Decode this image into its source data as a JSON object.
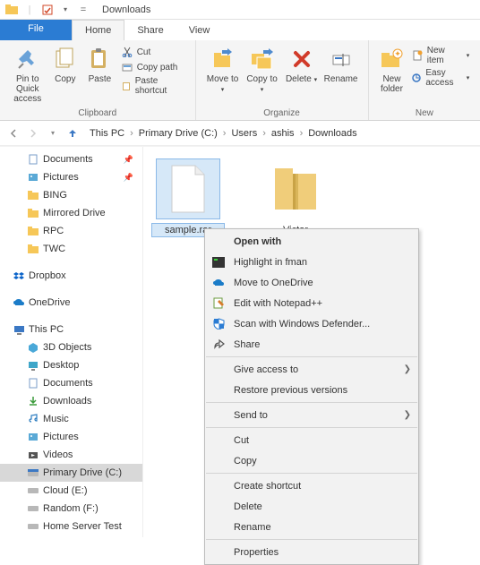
{
  "window": {
    "title": "Downloads"
  },
  "menubar": {
    "file": "File",
    "home": "Home",
    "share": "Share",
    "view": "View"
  },
  "ribbon": {
    "clipboard": {
      "label": "Clipboard",
      "pin": "Pin to Quick access",
      "copy": "Copy",
      "paste": "Paste",
      "cut": "Cut",
      "copy_path": "Copy path",
      "paste_shortcut": "Paste shortcut"
    },
    "organize": {
      "label": "Organize",
      "move_to": "Move to",
      "copy_to": "Copy to",
      "delete": "Delete",
      "rename": "Rename"
    },
    "new": {
      "label": "New",
      "new_folder": "New folder",
      "new_item": "New item",
      "easy_access": "Easy access"
    }
  },
  "breadcrumb": {
    "root": "This PC",
    "segs": [
      "Primary Drive (C:)",
      "Users",
      "ashis",
      "Downloads"
    ]
  },
  "sidebar": {
    "group1": [
      {
        "label": "Documents",
        "pinned": true
      },
      {
        "label": "Pictures",
        "pinned": true
      },
      {
        "label": "BING",
        "pinned": false
      },
      {
        "label": "Mirrored Drive",
        "pinned": false
      },
      {
        "label": "RPC",
        "pinned": false
      },
      {
        "label": "TWC",
        "pinned": false
      }
    ],
    "dropbox": "Dropbox",
    "onedrive": "OneDrive",
    "thispc": "This PC",
    "pcitems": [
      "3D Objects",
      "Desktop",
      "Documents",
      "Downloads",
      "Music",
      "Pictures",
      "Videos",
      "Primary Drive (C:)",
      "Cloud (E:)",
      "Random (F:)",
      "Home Server Test"
    ]
  },
  "files": [
    {
      "name": "sample.rar",
      "selected": true,
      "type": "blank"
    },
    {
      "name": "Victor",
      "selected": false,
      "type": "zip"
    }
  ],
  "contextmenu": {
    "open_with": "Open with",
    "highlight_fman": "Highlight in fman",
    "move_onedrive": "Move to OneDrive",
    "edit_notepad": "Edit with Notepad++",
    "scan_defender": "Scan with Windows Defender...",
    "share": "Share",
    "give_access": "Give access to",
    "restore": "Restore previous versions",
    "send_to": "Send to",
    "cut": "Cut",
    "copy": "Copy",
    "create_shortcut": "Create shortcut",
    "delete": "Delete",
    "rename": "Rename",
    "properties": "Properties"
  }
}
